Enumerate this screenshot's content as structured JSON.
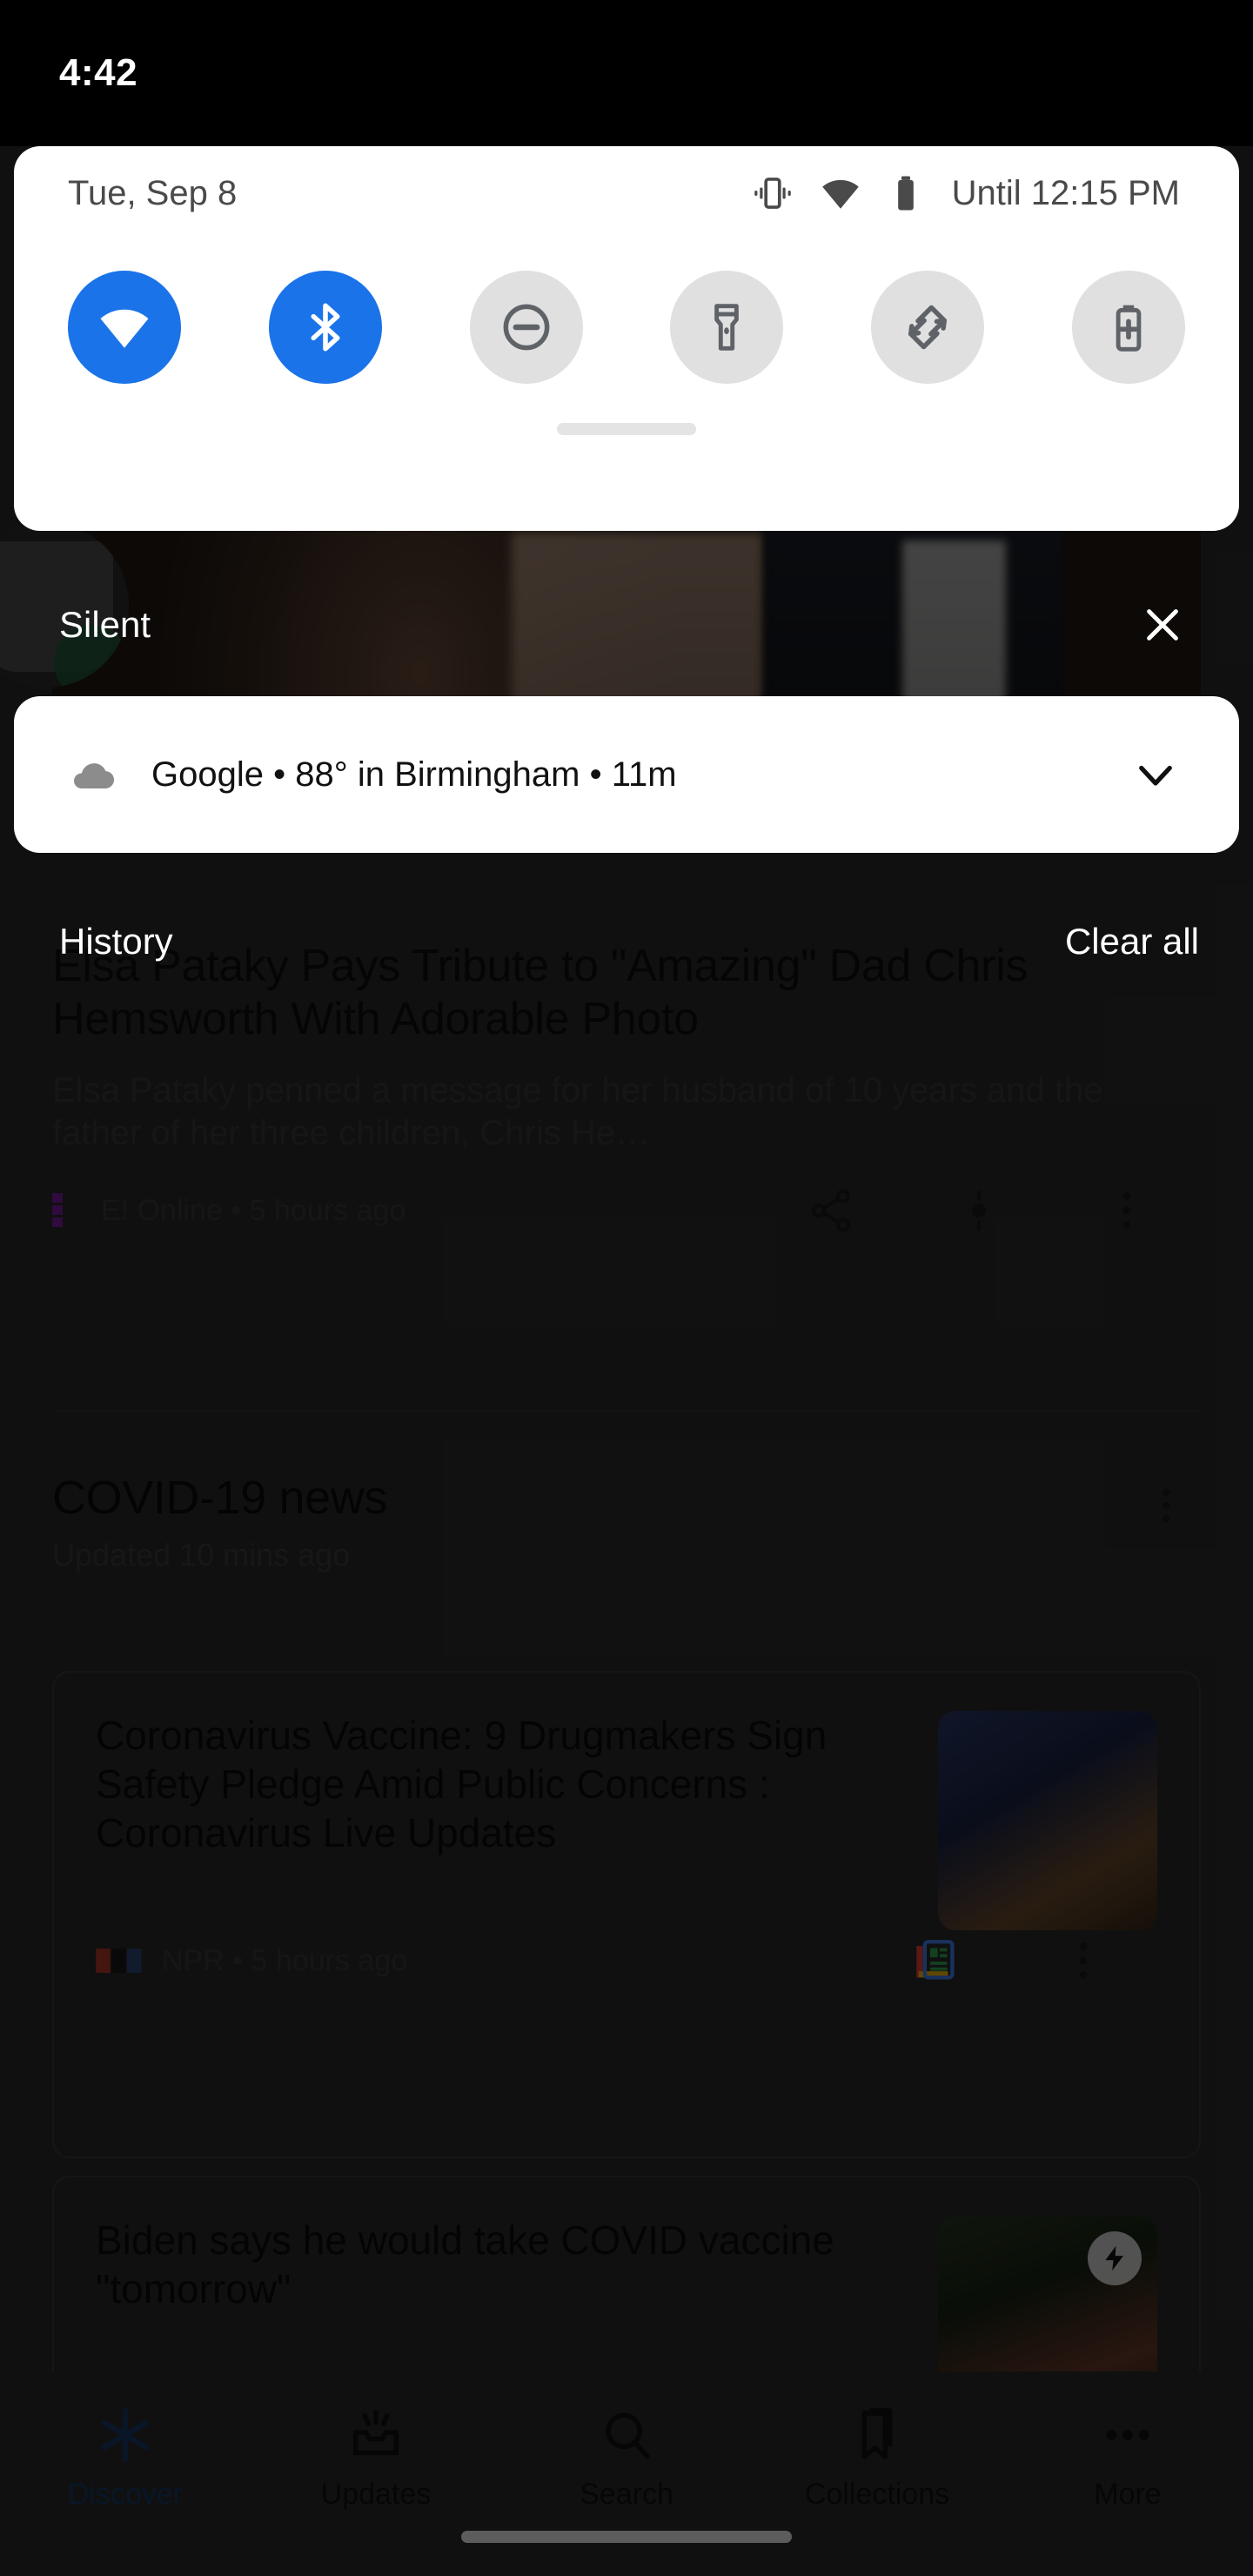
{
  "status_bar": {
    "clock": "4:42"
  },
  "quick_settings": {
    "date": "Tue, Sep 8",
    "battery_text": "Until 12:15 PM",
    "status_icons": [
      {
        "name": "vibrate-icon",
        "label": "Vibrate"
      },
      {
        "name": "wifi-icon",
        "label": "Wi-Fi"
      },
      {
        "name": "battery-icon",
        "label": "Battery"
      }
    ],
    "tiles": [
      {
        "name": "wifi-tile",
        "label": "Wi-Fi",
        "state": "on"
      },
      {
        "name": "bluetooth-tile",
        "label": "Bluetooth",
        "state": "on"
      },
      {
        "name": "dnd-tile",
        "label": "Do Not Disturb",
        "state": "off"
      },
      {
        "name": "flashlight-tile",
        "label": "Flashlight",
        "state": "off"
      },
      {
        "name": "auto-rotate-tile",
        "label": "Auto-rotate",
        "state": "off"
      },
      {
        "name": "battery-saver-tile",
        "label": "Battery Saver",
        "state": "off"
      }
    ],
    "drag_handle": "drag-handle"
  },
  "silent_section": {
    "title": "Silent",
    "close_label": "×"
  },
  "notification": {
    "app": "Google",
    "text": "Google • 88° in Birmingham • 11m",
    "temperature": "88°",
    "location": "Birmingham",
    "age": "11m",
    "icon": "cloud-icon",
    "expand_icon": "chevron-down-icon"
  },
  "notification_footer": {
    "history": "History",
    "clear_all": "Clear all"
  },
  "background_feed": {
    "featured_article": {
      "headline": "Elsa Pataky Pays Tribute to \"Amazing\" Dad Chris Hemsworth With Adorable Photo",
      "snippet": "Elsa Pataky penned a message for her husband of 10 years and the father of her three children, Chris He…",
      "source": "E! Online",
      "time": "5 hours ago",
      "meta": "E! Online • 5 hours ago"
    },
    "section": {
      "title": "COVID-19 news",
      "subtitle": "Updated 10 mins ago"
    },
    "articles": [
      {
        "headline": "Coronavirus Vaccine: 9 Drugmakers Sign Safety Pledge Amid Public Concerns : Coronavirus Live Updates",
        "source": "NPR",
        "time": "5 hours ago",
        "meta": "NPR • 5 hours ago"
      },
      {
        "headline": "Biden says he would take COVID vaccine \"tomorrow\"",
        "source": "",
        "time": "",
        "meta": ""
      }
    ]
  },
  "bottom_nav": {
    "items": [
      {
        "label": "Discover",
        "icon": "asterisk-icon",
        "active": true
      },
      {
        "label": "Updates",
        "icon": "inbox-icon",
        "active": false
      },
      {
        "label": "Search",
        "icon": "search-icon",
        "active": false
      },
      {
        "label": "Collections",
        "icon": "bookmark-icon",
        "active": false
      },
      {
        "label": "More",
        "icon": "more-horiz-icon",
        "active": false
      }
    ]
  },
  "colors": {
    "accent_blue": "#1a73e8",
    "tile_off": "#e0e0e0",
    "panel_bg": "#ffffff",
    "status_bar_bg": "#000000",
    "discover_blue": "#1a3a6b"
  }
}
